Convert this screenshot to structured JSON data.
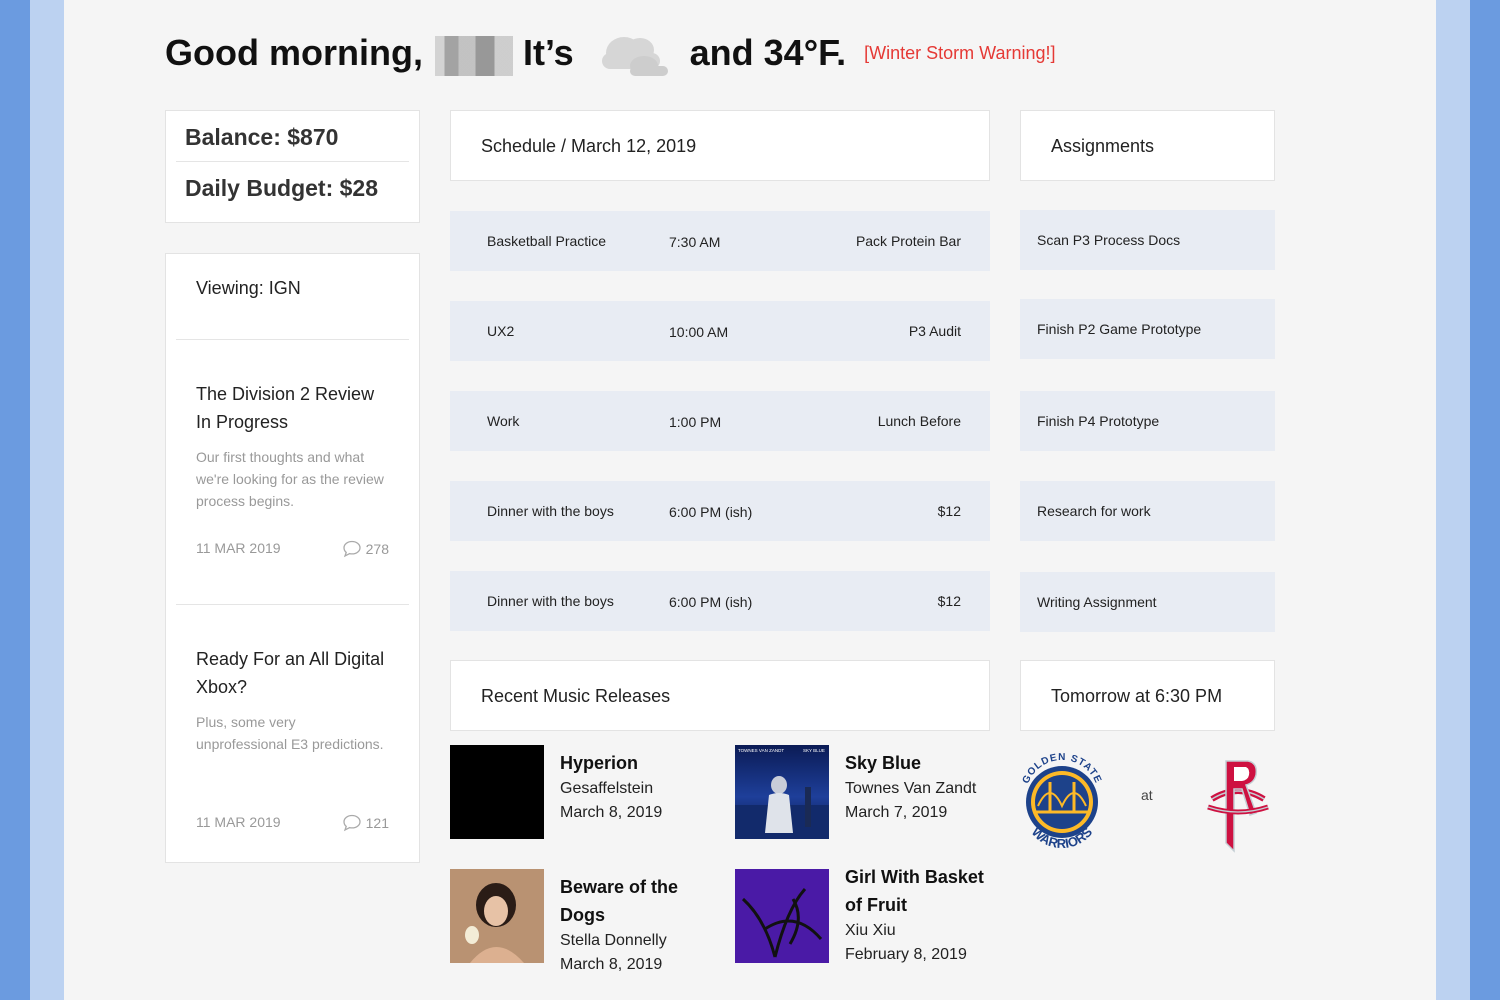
{
  "header": {
    "greeting": "Good morning,",
    "its": "It’s",
    "temperature": "and 34°F.",
    "warning": "[Winter Storm Warning!]",
    "weather_icon": "cloud-icon"
  },
  "finance": {
    "balance": "Balance: $870",
    "daily_budget": "Daily Budget: $28"
  },
  "news": {
    "viewing": "Viewing: IGN",
    "items": [
      {
        "title": "The Division 2 Review In Progress",
        "desc": "Our first thoughts and what we're looking for as the review process begins.",
        "date": "11 MAR 2019",
        "comments": "278"
      },
      {
        "title": "Ready For an All Digital Xbox?",
        "desc": "Plus, some very unprofessional E3 predictions.",
        "date": "11 MAR 2019",
        "comments": "121"
      }
    ]
  },
  "schedule": {
    "title": "Schedule / March 12, 2019",
    "rows": [
      {
        "event": "Basketball Practice",
        "time": "7:30 AM",
        "note": "Pack Protein Bar"
      },
      {
        "event": "UX2",
        "time": "10:00 AM",
        "note": "P3 Audit"
      },
      {
        "event": "Work",
        "time": "1:00 PM",
        "note": "Lunch Before"
      },
      {
        "event": "Dinner with the boys",
        "time": "6:00 PM (ish)",
        "note": "$12"
      },
      {
        "event": "Dinner with the boys",
        "time": "6:00 PM (ish)",
        "note": "$12"
      }
    ]
  },
  "assignments": {
    "title": "Assignments",
    "items": [
      "Scan P3 Process Docs",
      "Finish P2 Game Prototype",
      "Finish P4 Prototype",
      "Research for work",
      "Writing Assignment"
    ]
  },
  "music": {
    "title": "Recent Music Releases",
    "albums": [
      {
        "title": "Hyperion",
        "artist": "Gesaffelstein",
        "date": "March 8, 2019"
      },
      {
        "title": "Sky Blue",
        "artist": "Townes Van Zandt",
        "date": "March 7, 2019",
        "art_text": [
          "TOWNES VAN ZANDT",
          "SKY BLUE"
        ]
      },
      {
        "title": "Beware of the Dogs",
        "artist": "Stella Donnelly",
        "date": "March 8, 2019"
      },
      {
        "title": "Girl With Basket of Fruit",
        "artist": "Xiu Xiu",
        "date": "February 8, 2019"
      }
    ]
  },
  "game": {
    "title": "Tomorrow at 6:30 PM",
    "at": "at",
    "away_logo_text": [
      "GOLDEN STATE",
      "WARRIORS"
    ],
    "home_logo": "houston-rockets-logo"
  }
}
